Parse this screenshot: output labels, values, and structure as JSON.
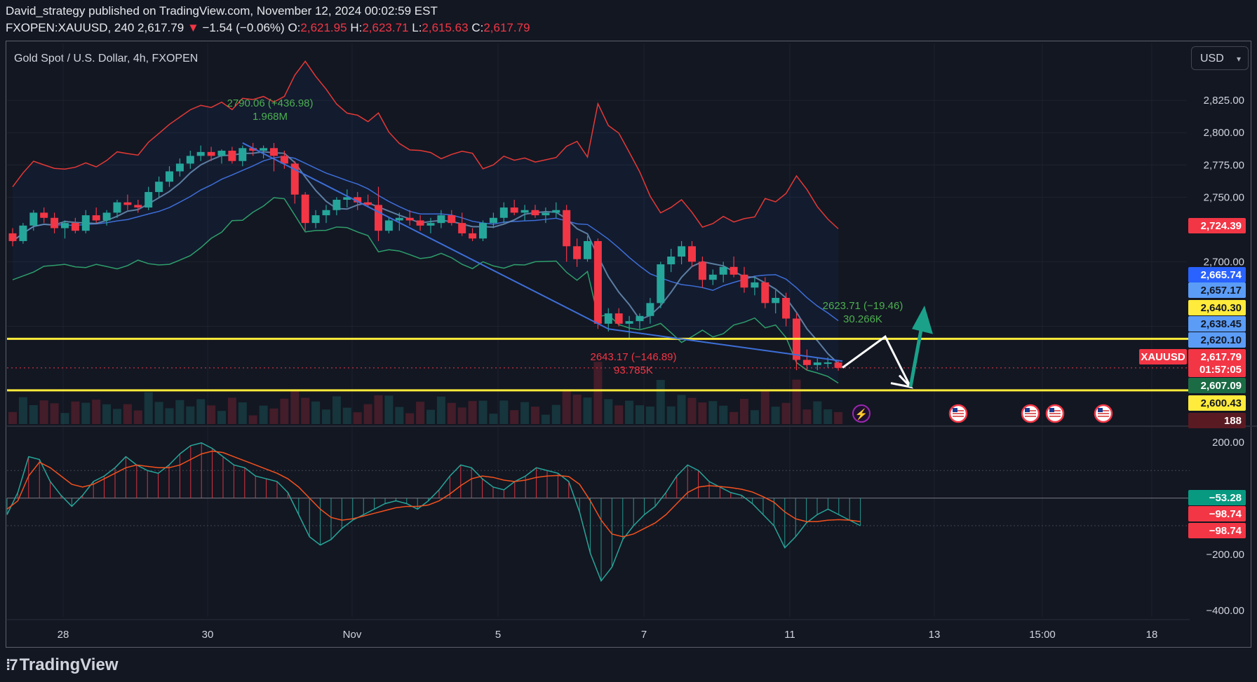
{
  "header": {
    "published": "David_strategy published on TradingView.com, November 12, 2024 00:02:59 EST",
    "symbol": "FXOPEN:XAUUSD, 240",
    "last": "2,617.79",
    "change_arrow": "▼",
    "change": "−1.54 (−0.06%)",
    "o_label": "O:",
    "o_val": "2,621.95",
    "h_label": "H:",
    "h_val": "2,623.71",
    "l_label": "L:",
    "l_val": "2,615.63",
    "c_label": "C:",
    "c_val": "2,617.79"
  },
  "pane_title": "Gold Spot / U.S. Dollar, 4h, FXOPEN",
  "currency_button": "USD",
  "brand": "TradingView",
  "icons": [
    "tradingview-logo-icon",
    "lightning-event-icon",
    "us-flag-event-icon",
    "dropdown-caret-icon"
  ],
  "colors": {
    "background": "#131722",
    "up": "#26a69a",
    "down": "#f23645",
    "support_line": "#ffeb3b",
    "band_upper": "#e53935",
    "band_lower": "#2e9e6b",
    "ma": "#3d6fd8",
    "arrow": "#1ba18a"
  },
  "chart_data": {
    "type": "candlestick",
    "symbol": "XAUUSD",
    "timeframe": "4h",
    "price_axis": {
      "range": [
        2577,
        2843
      ],
      "ticks": [
        "2,825.00",
        "2,800.00",
        "2,775.00",
        "2,750.00",
        "2,700.00"
      ]
    },
    "x_ticks": [
      "28",
      "30",
      "Nov",
      "5",
      "7",
      "11",
      "13",
      "15:00",
      "18"
    ],
    "price_labels": [
      {
        "text": "2,724.39",
        "price": 2724.39,
        "color": "#f23645"
      },
      {
        "text": "2,665.74",
        "price": 2665.74,
        "color": "#2962ff"
      },
      {
        "text": "2,657.17",
        "price": 2657.17,
        "color": "#5b9cf6"
      },
      {
        "text": "2,640.30",
        "price": 2640.3,
        "color": "#ffeb3b"
      },
      {
        "text": "2,638.45",
        "price": 2638.45,
        "color": "#5b9cf6"
      },
      {
        "text": "2,620.10",
        "price": 2620.1,
        "color": "#5b9cf6"
      },
      {
        "text": "2,617.79",
        "price": 2617.79,
        "color": "#f23645"
      },
      {
        "text": "01:57:05",
        "price": 2611.0,
        "color": "#f23645"
      },
      {
        "text": "2,607.09",
        "price": 2607.09,
        "color": "#1b6b45"
      },
      {
        "text": "2,600.43",
        "price": 2600.43,
        "color": "#ffeb3b"
      },
      {
        "text": "188",
        "price": 2592.0,
        "color": "#5a1a22"
      }
    ],
    "symbol_tag": "XAUUSD",
    "support_levels": [
      2640.3,
      2600.43
    ],
    "annotations": [
      {
        "line1": "2790.06 (+436.98)",
        "line2": "1.968M",
        "color": "#4caf50"
      },
      {
        "line1": "2623.71 (−19.46)",
        "line2": "30.266K",
        "color": "#4caf50"
      },
      {
        "line1": "2643.17 (−146.89)",
        "line2": "93.785K",
        "color": "#f23645"
      }
    ],
    "candles": [
      [
        2722,
        2726,
        2712,
        2716
      ],
      [
        2716,
        2730,
        2714,
        2728
      ],
      [
        2728,
        2740,
        2724,
        2738
      ],
      [
        2738,
        2742,
        2730,
        2734
      ],
      [
        2734,
        2738,
        2722,
        2726
      ],
      [
        2726,
        2732,
        2718,
        2730
      ],
      [
        2730,
        2734,
        2722,
        2724
      ],
      [
        2724,
        2740,
        2722,
        2736
      ],
      [
        2736,
        2742,
        2730,
        2732
      ],
      [
        2732,
        2740,
        2728,
        2738
      ],
      [
        2738,
        2748,
        2734,
        2746
      ],
      [
        2746,
        2752,
        2740,
        2744
      ],
      [
        2744,
        2748,
        2738,
        2742
      ],
      [
        2742,
        2758,
        2740,
        2754
      ],
      [
        2754,
        2766,
        2750,
        2762
      ],
      [
        2762,
        2774,
        2758,
        2770
      ],
      [
        2770,
        2780,
        2766,
        2776
      ],
      [
        2776,
        2786,
        2772,
        2782
      ],
      [
        2782,
        2790,
        2778,
        2785
      ],
      [
        2785,
        2789,
        2778,
        2782
      ],
      [
        2782,
        2787,
        2776,
        2786
      ],
      [
        2786,
        2789,
        2776,
        2778
      ],
      [
        2778,
        2790,
        2774,
        2788
      ],
      [
        2788,
        2792,
        2782,
        2786
      ],
      [
        2786,
        2790,
        2780,
        2788
      ],
      [
        2788,
        2792,
        2770,
        2782
      ],
      [
        2782,
        2786,
        2772,
        2776
      ],
      [
        2776,
        2778,
        2745,
        2752
      ],
      [
        2752,
        2754,
        2724,
        2730
      ],
      [
        2730,
        2740,
        2726,
        2736
      ],
      [
        2736,
        2744,
        2730,
        2740
      ],
      [
        2740,
        2750,
        2736,
        2748
      ],
      [
        2748,
        2756,
        2742,
        2750
      ],
      [
        2750,
        2754,
        2740,
        2746
      ],
      [
        2746,
        2752,
        2742,
        2744
      ],
      [
        2744,
        2758,
        2716,
        2724
      ],
      [
        2724,
        2734,
        2722,
        2732
      ],
      [
        2732,
        2738,
        2724,
        2734
      ],
      [
        2734,
        2740,
        2728,
        2732
      ],
      [
        2732,
        2736,
        2724,
        2728
      ],
      [
        2728,
        2734,
        2722,
        2730
      ],
      [
        2730,
        2740,
        2726,
        2736
      ],
      [
        2736,
        2740,
        2728,
        2730
      ],
      [
        2730,
        2738,
        2720,
        2722
      ],
      [
        2722,
        2726,
        2716,
        2718
      ],
      [
        2718,
        2732,
        2716,
        2730
      ],
      [
        2730,
        2738,
        2726,
        2734
      ],
      [
        2734,
        2746,
        2730,
        2742
      ],
      [
        2742,
        2748,
        2736,
        2738
      ],
      [
        2738,
        2744,
        2732,
        2740
      ],
      [
        2740,
        2744,
        2734,
        2736
      ],
      [
        2736,
        2742,
        2730,
        2738
      ],
      [
        2738,
        2746,
        2734,
        2740
      ],
      [
        2740,
        2744,
        2700,
        2712
      ],
      [
        2712,
        2718,
        2696,
        2702
      ],
      [
        2702,
        2720,
        2700,
        2716
      ],
      [
        2716,
        2718,
        2648,
        2652
      ],
      [
        2652,
        2664,
        2646,
        2660
      ],
      [
        2660,
        2664,
        2650,
        2652
      ],
      [
        2652,
        2658,
        2640,
        2654
      ],
      [
        2654,
        2660,
        2648,
        2658
      ],
      [
        2658,
        2672,
        2652,
        2668
      ],
      [
        2668,
        2700,
        2664,
        2698
      ],
      [
        2698,
        2710,
        2692,
        2704
      ],
      [
        2704,
        2716,
        2698,
        2712
      ],
      [
        2712,
        2716,
        2696,
        2700
      ],
      [
        2700,
        2704,
        2680,
        2686
      ],
      [
        2686,
        2694,
        2682,
        2690
      ],
      [
        2690,
        2700,
        2684,
        2696
      ],
      [
        2696,
        2704,
        2688,
        2690
      ],
      [
        2690,
        2696,
        2676,
        2680
      ],
      [
        2680,
        2688,
        2674,
        2684
      ],
      [
        2684,
        2688,
        2664,
        2668
      ],
      [
        2668,
        2678,
        2660,
        2672
      ],
      [
        2672,
        2676,
        2650,
        2656
      ],
      [
        2656,
        2660,
        2616,
        2624
      ],
      [
        2624,
        2632,
        2616,
        2620
      ],
      [
        2620,
        2626,
        2616,
        2622
      ],
      [
        2622,
        2626,
        2618,
        2622
      ],
      [
        2621.95,
        2623.71,
        2615.63,
        2617.79
      ]
    ],
    "volume_label": "188",
    "oscillator": {
      "ticks": [
        "200.00",
        "−200.00",
        "−400.00"
      ],
      "range": [
        -430,
        225
      ],
      "last_labels": [
        {
          "text": "−53.28",
          "value": 0,
          "color": "#089981"
        },
        {
          "text": "−98.74",
          "value": -42,
          "color": "#f23645"
        },
        {
          "text": "−98.74",
          "value": -100,
          "color": "#f23645"
        }
      ],
      "fast": [
        -60,
        20,
        150,
        140,
        60,
        10,
        -30,
        10,
        60,
        80,
        110,
        150,
        120,
        100,
        90,
        120,
        160,
        190,
        200,
        180,
        150,
        120,
        110,
        80,
        70,
        60,
        20,
        -60,
        -140,
        -170,
        -150,
        -110,
        -80,
        -60,
        -40,
        -20,
        -10,
        -20,
        -40,
        -10,
        30,
        80,
        120,
        110,
        70,
        40,
        30,
        60,
        80,
        110,
        100,
        90,
        60,
        -50,
        -200,
        -300,
        -250,
        -150,
        -100,
        -60,
        -30,
        20,
        80,
        120,
        100,
        60,
        40,
        20,
        10,
        -20,
        -60,
        -100,
        -180,
        -140,
        -90,
        -60,
        -40,
        -60,
        -80,
        -100
      ],
      "slow": [
        -40,
        -10,
        80,
        130,
        110,
        80,
        50,
        40,
        50,
        70,
        90,
        110,
        120,
        115,
        110,
        110,
        120,
        140,
        160,
        170,
        165,
        150,
        135,
        120,
        105,
        90,
        70,
        40,
        0,
        -40,
        -70,
        -80,
        -75,
        -65,
        -55,
        -45,
        -35,
        -30,
        -30,
        -25,
        -10,
        15,
        45,
        70,
        80,
        75,
        65,
        60,
        65,
        75,
        80,
        82,
        78,
        50,
        -10,
        -80,
        -130,
        -140,
        -130,
        -110,
        -90,
        -60,
        -20,
        20,
        40,
        45,
        42,
        38,
        32,
        22,
        5,
        -15,
        -50,
        -75,
        -85,
        -85,
        -80,
        -78,
        -80,
        -85
      ]
    }
  }
}
